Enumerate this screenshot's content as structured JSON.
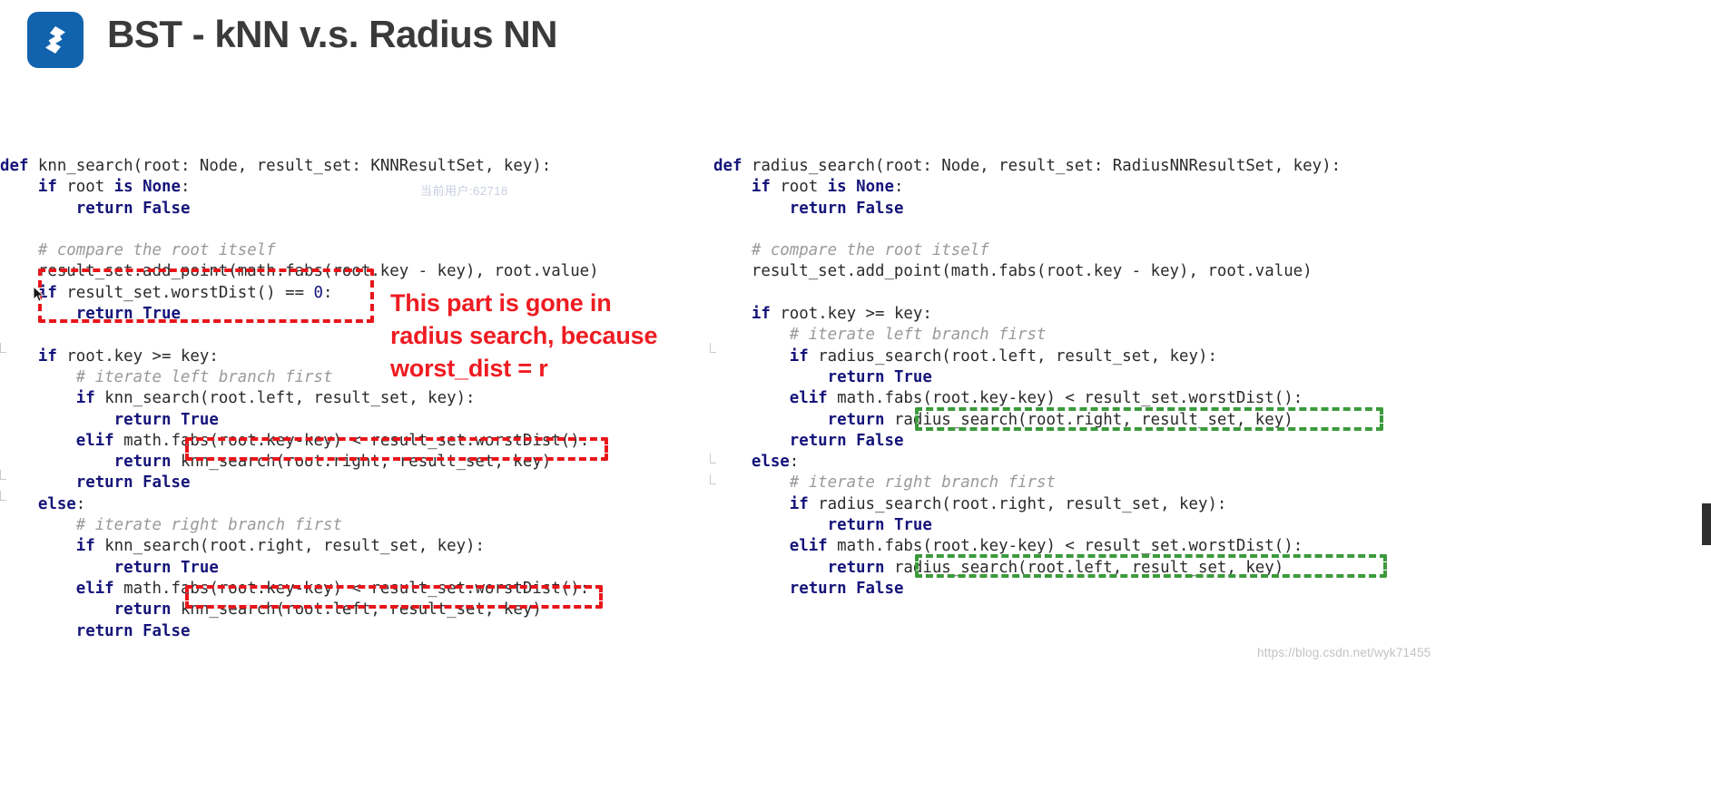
{
  "header": {
    "title": "BST - kNN v.s. Radius NN",
    "logo_icon": "shards-logo-icon",
    "logo_color": "#1263ae",
    "title_color": "#3a3a3a"
  },
  "colors": {
    "keyword": "#15147a",
    "comment": "#9a9a9a",
    "plain": "#2b2b2b",
    "annotation_red": "#ee1c22",
    "dash_red": "#e8161a",
    "dash_green": "#3c9a3c"
  },
  "left_code": {
    "name": "knn_search",
    "lines": [
      "def knn_search(root: Node, result_set: KNNResultSet, key):",
      "    if root is None:",
      "        return False",
      "",
      "    # compare the root itself",
      "    result_set.add_point(math.fabs(root.key - key), root.value)",
      "    if result_set.worstDist() == 0:",
      "        return True",
      "",
      "    if root.key >= key:",
      "        # iterate left branch first",
      "        if knn_search(root.left, result_set, key):",
      "            return True",
      "        elif math.fabs(root.key-key) < result_set.worstDist():",
      "            return knn_search(root.right, result_set, key)",
      "        return False",
      "    else:",
      "        # iterate right branch first",
      "        if knn_search(root.right, result_set, key):",
      "            return True",
      "        elif math.fabs(root.key-key) < result_set.worstDist():",
      "            return knn_search(root.left, result_set, key)",
      "        return False"
    ]
  },
  "right_code": {
    "name": "radius_search",
    "lines": [
      "def radius_search(root: Node, result_set: RadiusNNResultSet, key):",
      "    if root is None:",
      "        return False",
      "",
      "    # compare the root itself",
      "    result_set.add_point(math.fabs(root.key - key), root.value)",
      "",
      "    if root.key >= key:",
      "        # iterate left branch first",
      "        if radius_search(root.left, result_set, key):",
      "            return True",
      "        elif math.fabs(root.key-key) < result_set.worstDist():",
      "            return radius_search(root.right, result_set, key)",
      "        return False",
      "    else:",
      "        # iterate right branch first",
      "        if radius_search(root.right, result_set, key):",
      "            return True",
      "        elif math.fabs(root.key-key) < result_set.worstDist():",
      "            return radius_search(root.left, result_set, key)",
      "        return False"
    ]
  },
  "annotation": {
    "text": "This part is gone in\nradius search, because\nworst_dist = r"
  },
  "highlights": {
    "red_boxes": [
      {
        "label": "worstDist-zero-check-box",
        "note": "if result_set.worstDist() == 0: / return True"
      },
      {
        "label": "knn-search-right-call-box",
        "note": "knn_search(root.right, result_set, key)"
      },
      {
        "label": "knn-search-left-call-box",
        "note": "knn_search(root.left, result_set, key)"
      }
    ],
    "green_boxes": [
      {
        "label": "radius-search-right-call-box",
        "note": "radius_search(root.right, result_set, key)"
      },
      {
        "label": "radius-search-left-call-box",
        "note": "radius_search(root.left, result_set, key)"
      }
    ]
  },
  "watermarks": {
    "user": "当前用户:62718",
    "blog": "https://blog.csdn.net/wyk71455"
  }
}
